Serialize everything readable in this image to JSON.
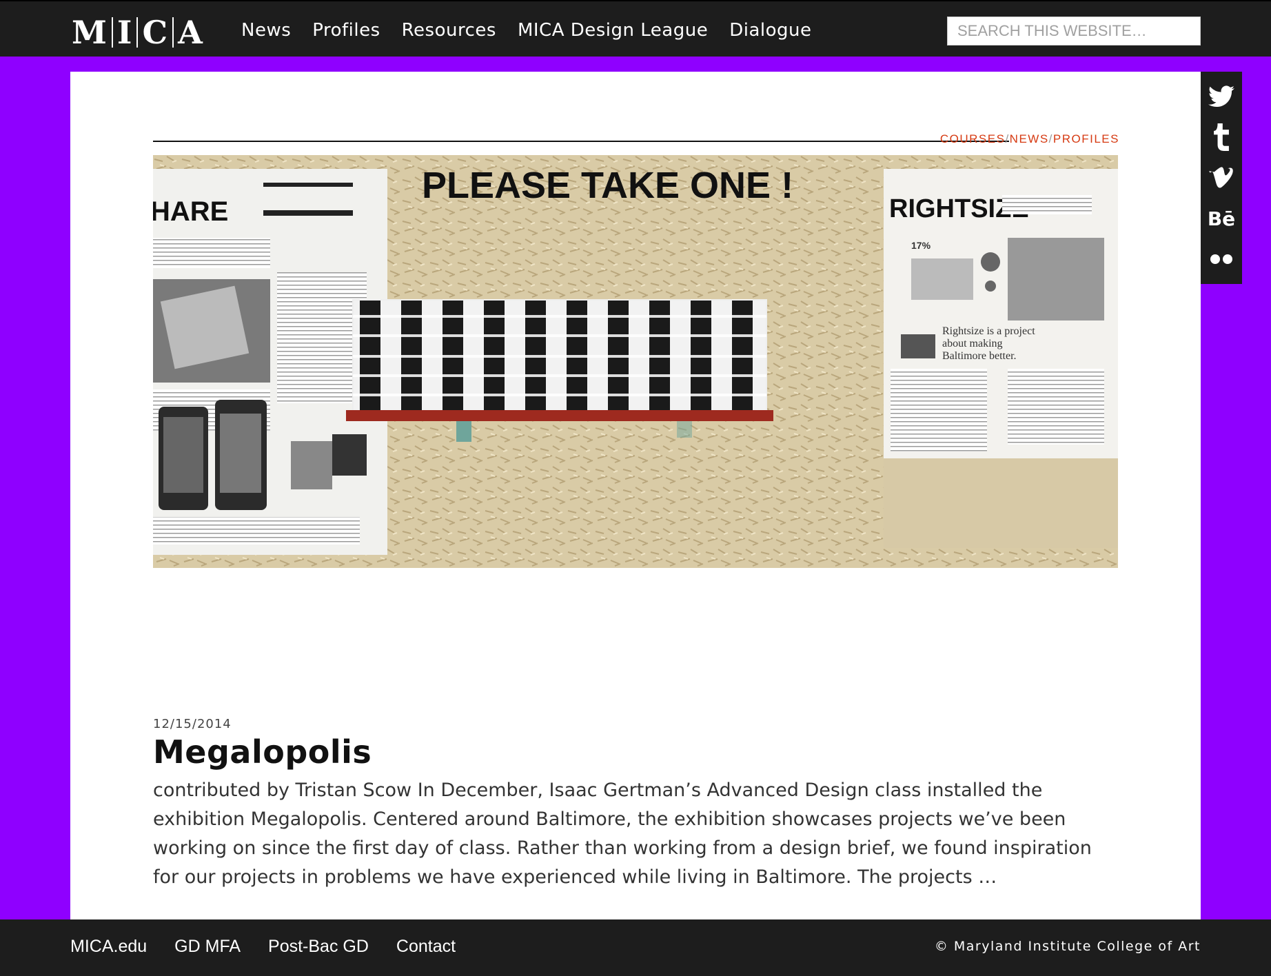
{
  "header": {
    "logo_letters": [
      "M",
      "I",
      "C",
      "A"
    ],
    "nav": [
      "News",
      "Profiles",
      "Resources",
      "MICA Design League",
      "Dialogue"
    ],
    "search_placeholder": "SEARCH THIS WEBSITE…"
  },
  "post": {
    "categories": [
      "COURSES",
      "NEWS",
      "PROFILES"
    ],
    "image_sign_text": "PLEASE TAKE ONE !",
    "image_poster_left_title": "HARE",
    "image_poster_right_title": "RIGHTSIZE",
    "image_poster_right_tagline": "Rightsize is a project about making Baltimore better.",
    "image_poster_right_stat": "17%",
    "date": "12/15/2014",
    "title": "Megalopolis",
    "excerpt": "contributed by Tristan Scow In December, Isaac Gertman’s Advanced Design class installed the exhibition Megalopolis. Centered around Baltimore, the exhibition showcases projects we’ve been working on since the first day of class. Rather than working from a design brief, we found inspiration for our projects in problems we have experienced while living in Baltimore. The projects …"
  },
  "social": {
    "icons": [
      "twitter-icon",
      "tumblr-icon",
      "vimeo-icon",
      "behance-icon",
      "flickr-icon"
    ],
    "behance_text": "Bē"
  },
  "footer": {
    "links": [
      "MICA.edu",
      "GD MFA",
      "Post-Bac GD",
      "Contact"
    ],
    "copyright": "© Maryland Institute College of Art"
  }
}
